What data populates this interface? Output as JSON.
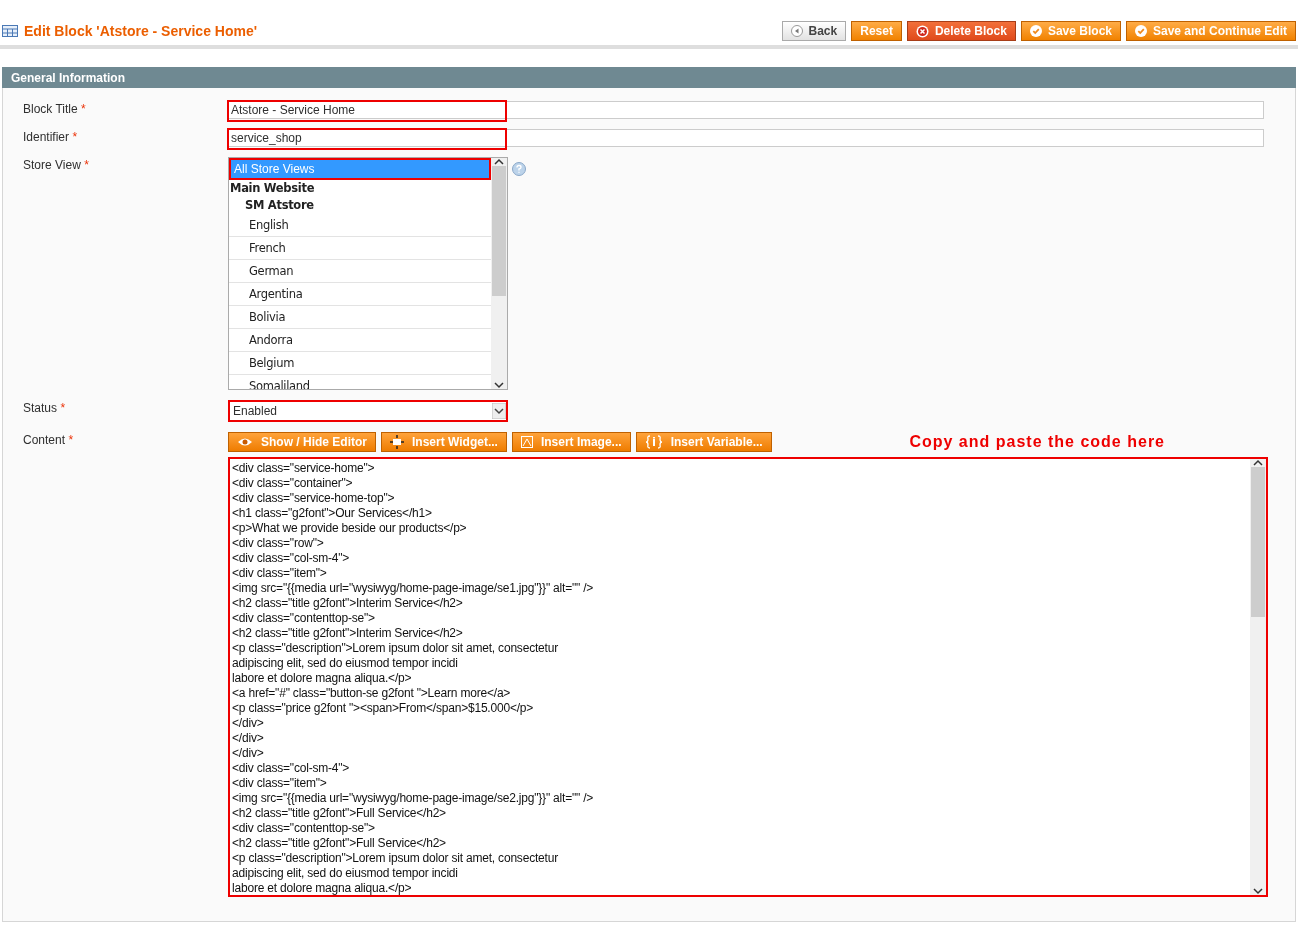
{
  "header": {
    "title": "Edit Block 'Atstore - Service Home'"
  },
  "actions": [
    {
      "label": "Back",
      "kind": "back"
    },
    {
      "label": "Reset",
      "kind": "plain"
    },
    {
      "label": "Delete Block",
      "kind": "delete"
    },
    {
      "label": "Save Block",
      "kind": "save"
    },
    {
      "label": "Save and Continue Edit",
      "kind": "save"
    }
  ],
  "section": {
    "title": "General Information"
  },
  "form": {
    "block_title": {
      "label": "Block Title",
      "required": "*",
      "value": "Atstore - Service Home"
    },
    "identifier": {
      "label": "Identifier",
      "required": "*",
      "value": "service_shop"
    },
    "store_view": {
      "label": "Store View",
      "required": "*",
      "options": [
        {
          "label": "All Store Views",
          "kind": "option",
          "selected": true
        },
        {
          "label": "Main Website",
          "kind": "website",
          "selected": false
        },
        {
          "label": "SM Atstore",
          "kind": "store",
          "selected": false
        },
        {
          "label": "English",
          "kind": "view",
          "selected": false
        },
        {
          "label": "French",
          "kind": "view",
          "selected": false
        },
        {
          "label": "German",
          "kind": "view",
          "selected": false
        },
        {
          "label": "Argentina",
          "kind": "view",
          "selected": false
        },
        {
          "label": "Bolivia",
          "kind": "view",
          "selected": false
        },
        {
          "label": "Andorra",
          "kind": "view",
          "selected": false
        },
        {
          "label": "Belgium",
          "kind": "view",
          "selected": false
        },
        {
          "label": "Somaliland",
          "kind": "view",
          "selected": false
        }
      ]
    },
    "status": {
      "label": "Status",
      "required": "*",
      "value": "Enabled"
    },
    "content": {
      "label": "Content",
      "required": "*",
      "buttons": [
        {
          "label": "Show / Hide Editor",
          "kind": "eye"
        },
        {
          "label": "Insert Widget...",
          "kind": "widget"
        },
        {
          "label": "Insert Image...",
          "kind": "image"
        },
        {
          "label": "Insert Variable...",
          "kind": "variable"
        }
      ],
      "annotation": "Copy and paste the code here",
      "lines": [
        "<div class=\"service-home\">",
        "<div class=\"container\">",
        "<div class=\"service-home-top\">",
        "<h1 class=\"g2font\">Our Services</h1>",
        "<p>What we provide beside our products</p>",
        "<div class=\"row\">",
        "<div class=\"col-sm-4\">",
        "<div class=\"item\">",
        "<img src=\"{{media url=\"wysiwyg/home-page-image/se1.jpg\"}}\" alt=\"\" />",
        "<h2 class=\"title g2font\">Interim Service</h2>",
        "<div class=\"contenttop-se\">",
        "<h2 class=\"title g2font\">Interim Service</h2>",
        "<p class=\"description\">Lorem ipsum dolor sit amet, consectetur",
        "adipiscing elit, sed do eiusmod tempor incidi",
        "labore et dolore magna aliqua.</p>",
        "<a href=\"#\" class=\"button-se g2font \">Learn more</a>",
        "<p class=\"price g2font \"><span>From</span>$15.000</p>",
        "</div>",
        "</div>",
        "</div>",
        "<div class=\"col-sm-4\">",
        "<div class=\"item\">",
        "<img src=\"{{media url=\"wysiwyg/home-page-image/se2.jpg\"}}\" alt=\"\" />",
        "<h2 class=\"title g2font\">Full Service</h2>",
        "<div class=\"contenttop-se\">",
        "<h2 class=\"title g2font\">Full Service</h2>",
        "<p class=\"description\">Lorem ipsum dolor sit amet, consectetur",
        "adipiscing elit, sed do eiusmod tempor incidi",
        "labore et dolore magna aliqua.</p>"
      ]
    }
  }
}
